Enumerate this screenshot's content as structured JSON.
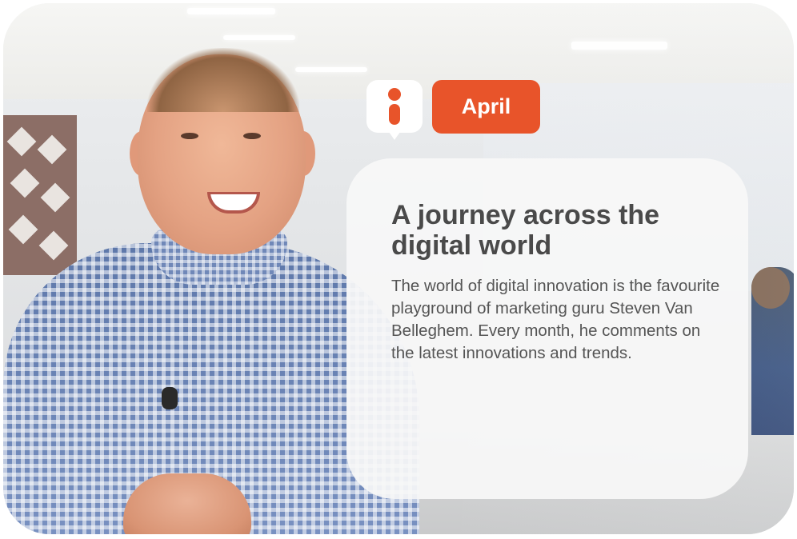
{
  "badge": {
    "icon": "info-icon",
    "accent_color": "#e8542a"
  },
  "month": {
    "label": "April"
  },
  "article": {
    "headline": "A journey across the digital world",
    "body": "The world of digital innovation is the favourite playground of marketing guru Steven Van Belleghem. Every month, he comments on the latest innovations and trends."
  },
  "colors": {
    "card_background": "#f8f8f8",
    "headline_text": "#4a4a4a",
    "body_text": "#555555"
  }
}
